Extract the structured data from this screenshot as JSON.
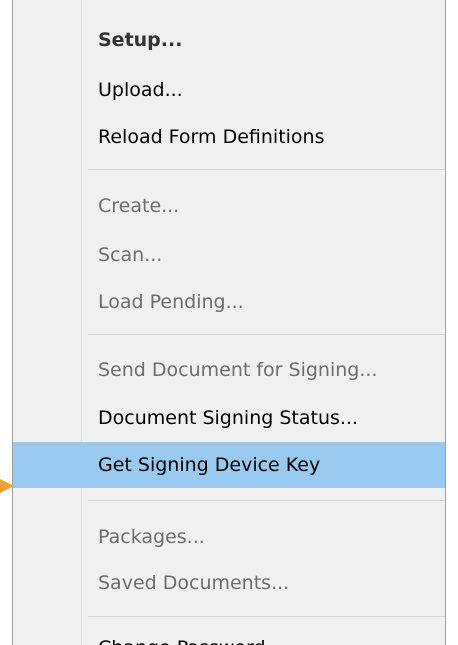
{
  "context_menu": {
    "groups": [
      {
        "items": [
          {
            "label": "Setup...",
            "state": "default-bold"
          },
          {
            "label": "Upload...",
            "state": "enabled"
          },
          {
            "label": "Reload Form Definitions",
            "state": "enabled"
          }
        ]
      },
      {
        "items": [
          {
            "label": "Create...",
            "state": "disabled"
          },
          {
            "label": "Scan...",
            "state": "disabled"
          },
          {
            "label": "Load Pending...",
            "state": "disabled"
          }
        ]
      },
      {
        "items": [
          {
            "label": "Send Document for Signing...",
            "state": "disabled"
          },
          {
            "label": "Document Signing Status...",
            "state": "enabled"
          },
          {
            "label": "Get Signing Device Key",
            "state": "enabled-highlighted"
          }
        ]
      },
      {
        "items": [
          {
            "label": "Packages...",
            "state": "disabled"
          },
          {
            "label": "Saved Documents...",
            "state": "disabled"
          }
        ]
      },
      {
        "items": [
          {
            "label": "Change Password...",
            "state": "enabled-partially-visible"
          }
        ]
      }
    ]
  },
  "colors": {
    "menu_background": "#f0f0f0",
    "highlight": "#99c9ef",
    "disabled_text": "#6d6d6d",
    "enabled_text": "#000000",
    "pointer_arrow": "#f0a12f"
  },
  "annotation": {
    "pointer": "orange-arrow-icon",
    "points_to": "Get Signing Device Key"
  }
}
